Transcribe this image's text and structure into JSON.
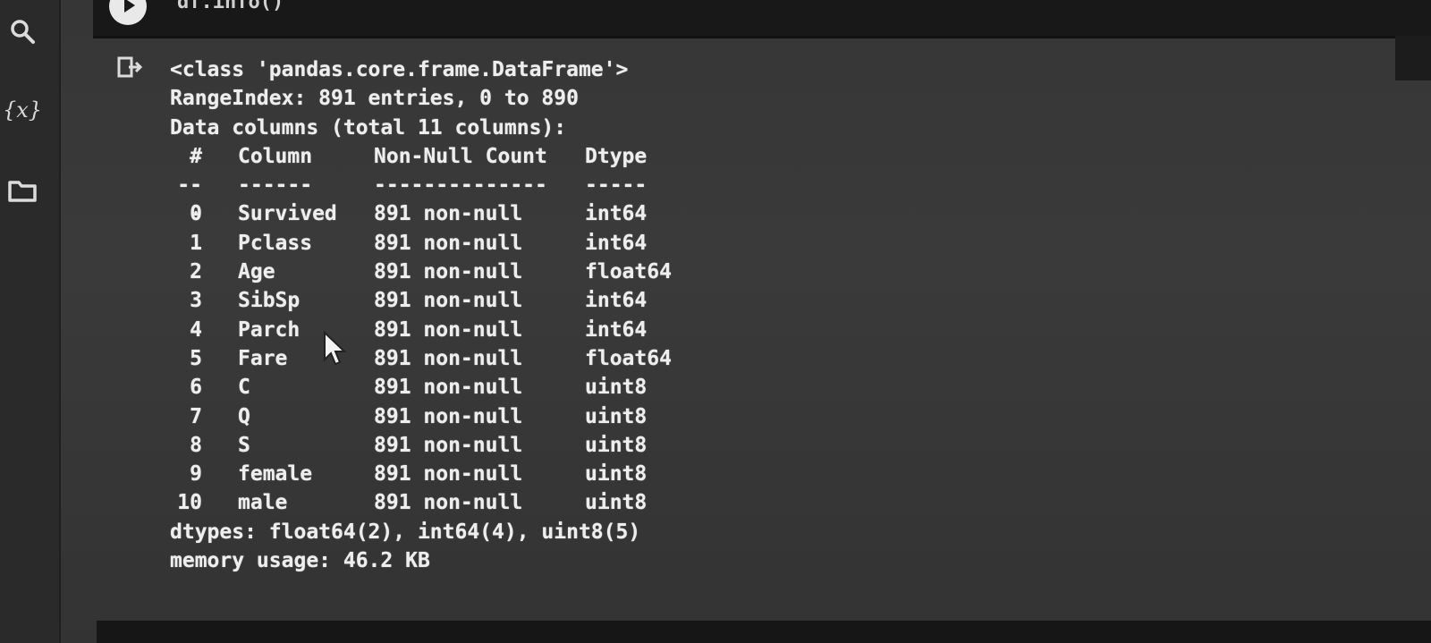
{
  "sidebar": {
    "items": [
      {
        "icon": "search-icon"
      },
      {
        "icon": "variables-icon",
        "label": "{x}"
      },
      {
        "icon": "folder-icon"
      }
    ]
  },
  "cell": {
    "code": "df.info()"
  },
  "output": {
    "class_line": "<class 'pandas.core.frame.DataFrame'>",
    "range_index": "RangeIndex: 891 entries, 0 to 890",
    "data_columns": "Data columns (total 11 columns):",
    "headers": [
      "#",
      "Column",
      "Non-Null Count",
      "Dtype"
    ],
    "separators": [
      "---",
      "------",
      "--------------",
      "-----"
    ],
    "rows": [
      {
        "idx": "0",
        "column": "Survived",
        "count": "891 non-null",
        "dtype": "int64"
      },
      {
        "idx": "1",
        "column": "Pclass",
        "count": "891 non-null",
        "dtype": "int64"
      },
      {
        "idx": "2",
        "column": "Age",
        "count": "891 non-null",
        "dtype": "float64"
      },
      {
        "idx": "3",
        "column": "SibSp",
        "count": "891 non-null",
        "dtype": "int64"
      },
      {
        "idx": "4",
        "column": "Parch",
        "count": "891 non-null",
        "dtype": "int64"
      },
      {
        "idx": "5",
        "column": "Fare",
        "count": "891 non-null",
        "dtype": "float64"
      },
      {
        "idx": "6",
        "column": "C",
        "count": "891 non-null",
        "dtype": "uint8"
      },
      {
        "idx": "7",
        "column": "Q",
        "count": "891 non-null",
        "dtype": "uint8"
      },
      {
        "idx": "8",
        "column": "S",
        "count": "891 non-null",
        "dtype": "uint8"
      },
      {
        "idx": "9",
        "column": "female",
        "count": "891 non-null",
        "dtype": "uint8"
      },
      {
        "idx": "10",
        "column": "male",
        "count": "891 non-null",
        "dtype": "uint8"
      }
    ],
    "dtypes_line": "dtypes: float64(2), int64(4), uint8(5)",
    "memory_line": "memory usage: 46.2 KB"
  }
}
